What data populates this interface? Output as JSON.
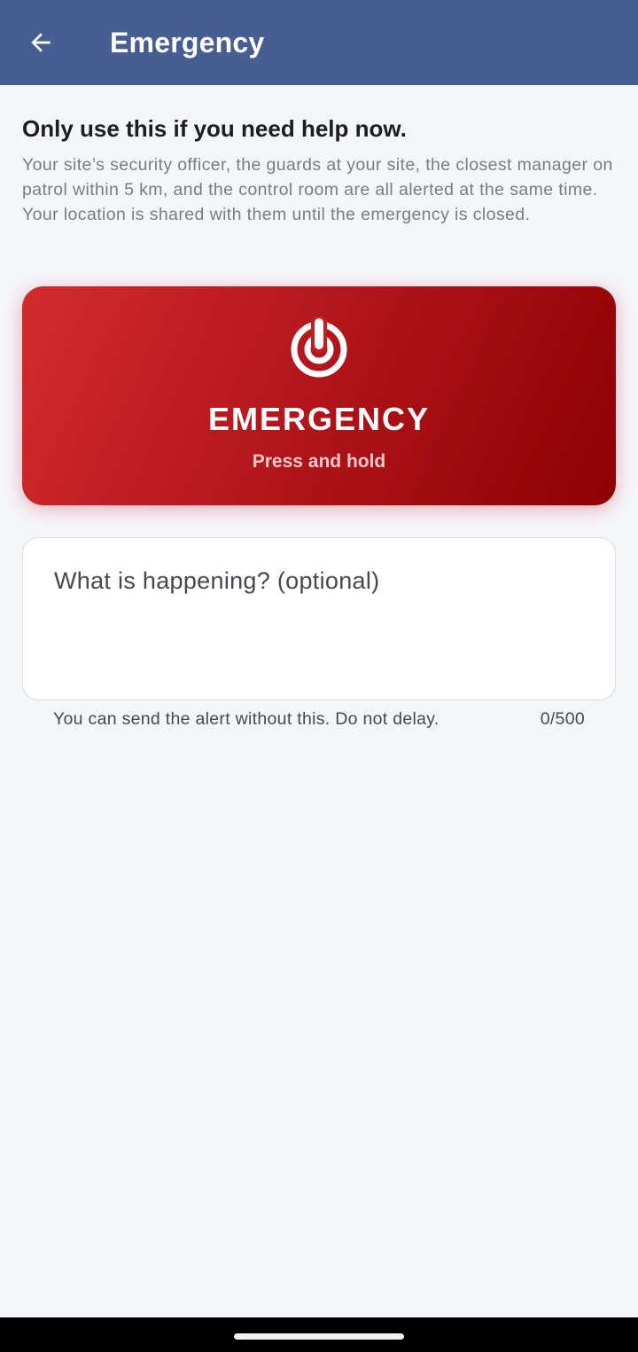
{
  "app_bar": {
    "title": "Emergency",
    "back_icon": "arrow-back-icon",
    "background_color": "#475e93"
  },
  "intro": {
    "headline": "Only use this if you need help now.",
    "description": "Your site’s security officer, the guards at your site, the closest manager on patrol within 5 km, and the control room are all alerted at the same time. Your location is shared with them until the emergency is closed."
  },
  "emergency_button": {
    "icon": "alarm-icon",
    "label": "EMERGENCY",
    "sublabel": "Press and hold",
    "gradient_start": "#d22b2f",
    "gradient_end": "#8e0003"
  },
  "note_field": {
    "placeholder": "What is happening? (optional)",
    "value": "",
    "helper_text": "You can send the alert without this. Do not delay.",
    "counter": "0/500"
  }
}
